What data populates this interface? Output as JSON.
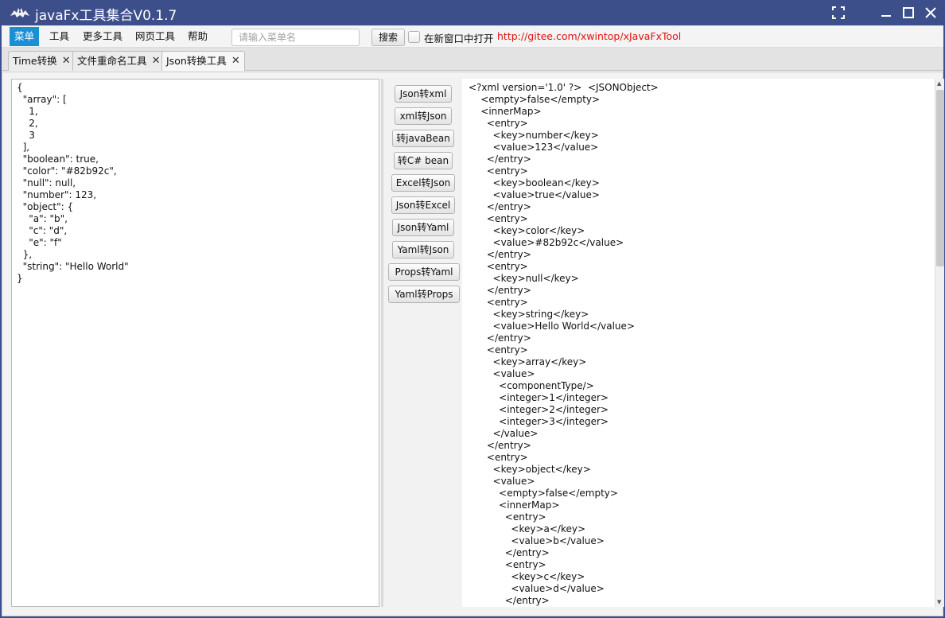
{
  "titlebar": {
    "title": "javaFx工具集合V0.1.7",
    "logo_icon": "bat-logo-icon",
    "buttons": [
      "fullscreen-icon",
      "minimize-icon",
      "maximize-icon",
      "close-icon"
    ]
  },
  "menubar": {
    "items": [
      "菜单",
      "工具",
      "更多工具",
      "网页工具",
      "帮助"
    ],
    "active_item": "菜单",
    "search_placeholder": "请输入菜单名",
    "search_value": "",
    "search_button": "搜索",
    "new_window_label": "在新窗口中打开",
    "new_window_checked": false,
    "repo_link": "http://gitee.com/xwintop/xJavaFxTool"
  },
  "tabs": [
    {
      "label": "Time转换",
      "close": "✕"
    },
    {
      "label": "文件重命名工具",
      "close": "✕"
    },
    {
      "label": "Json转换工具",
      "close": "✕"
    }
  ],
  "active_tab": "Json转换工具",
  "json_input": "{\n  \"array\": [\n    1,\n    2,\n    3\n  ],\n  \"boolean\": true,\n  \"color\": \"#82b92c\",\n  \"null\": null,\n  \"number\": 123,\n  \"object\": {\n    \"a\": \"b\",\n    \"c\": \"d\",\n    \"e\": \"f\"\n  },\n  \"string\": \"Hello World\"\n}",
  "tool_buttons": [
    "Json转xml",
    "xml转Json",
    "转javaBean",
    "转C# bean",
    "Excel转Json",
    "Json转Excel",
    "Json转Yaml",
    "Yaml转Json",
    "Props转Yaml",
    "Yaml转Props"
  ],
  "xml_output": "<?xml version='1.0' ?>  <JSONObject>\n    <empty>false</empty>\n    <innerMap>\n      <entry>\n        <key>number</key>\n        <value>123</value>\n      </entry>\n      <entry>\n        <key>boolean</key>\n        <value>true</value>\n      </entry>\n      <entry>\n        <key>color</key>\n        <value>#82b92c</value>\n      </entry>\n      <entry>\n        <key>null</key>\n      </entry>\n      <entry>\n        <key>string</key>\n        <value>Hello World</value>\n      </entry>\n      <entry>\n        <key>array</key>\n        <value>\n          <componentType/>\n          <integer>1</integer>\n          <integer>2</integer>\n          <integer>3</integer>\n        </value>\n      </entry>\n      <entry>\n        <key>object</key>\n        <value>\n          <empty>false</empty>\n          <innerMap>\n            <entry>\n              <key>a</key>\n              <value>b</value>\n            </entry>\n            <entry>\n              <key>c</key>\n              <value>d</value>\n            </entry>",
  "colors": {
    "titlebar": "#3c4f8b",
    "menu_active": "#1a8fd1",
    "link": "#e0130c"
  }
}
